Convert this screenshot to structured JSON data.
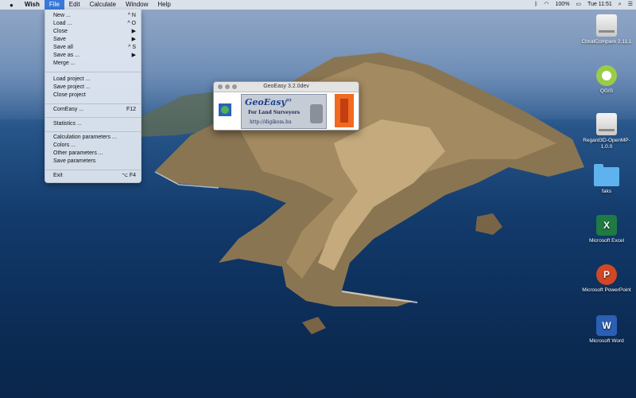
{
  "menubar": {
    "apple_icon": "apple-logo-icon",
    "items": [
      "Wish",
      "File",
      "Edit",
      "Calculate",
      "Window",
      "Help"
    ],
    "status": {
      "bluetooth_icon": "bluetooth-icon",
      "wifi_icon": "wifi-icon",
      "battery": "100%",
      "clock": "Tue 11:51",
      "search_icon": "spotlight-search-icon",
      "list_icon": "notification-list-icon"
    }
  },
  "file_menu": {
    "items": [
      {
        "label": "New ...",
        "shortcut": "^ N"
      },
      {
        "label": "Load ...",
        "shortcut": "^ O"
      },
      {
        "label": "Close",
        "shortcut": "▶"
      },
      {
        "label": "Save",
        "shortcut": "▶"
      },
      {
        "label": "Save all",
        "shortcut": "^ S"
      },
      {
        "label": "Save as ...",
        "shortcut": "▶"
      },
      {
        "label": "Merge ...",
        "shortcut": ""
      },
      {
        "label": "Load project ...",
        "shortcut": ""
      },
      {
        "label": "Save project ...",
        "shortcut": ""
      },
      {
        "label": "Close project",
        "shortcut": ""
      },
      {
        "label": "ComEasy ...",
        "shortcut": "F12"
      },
      {
        "label": "Statistics ...",
        "shortcut": ""
      },
      {
        "label": "Calculation parameters ...",
        "shortcut": ""
      },
      {
        "label": "Colors ...",
        "shortcut": ""
      },
      {
        "label": "Other parameters ...",
        "shortcut": ""
      },
      {
        "label": "Save parameters",
        "shortcut": ""
      },
      {
        "label": "Exit",
        "shortcut": "⌥ F4"
      }
    ]
  },
  "splash": {
    "title": "GeoEasy 3.2.0dev",
    "brand": "GeoEasy",
    "brand_sup": "95",
    "tagline": "For Land Surveyors",
    "url": "http://digikom.hu"
  },
  "desktop_icons": [
    {
      "label": "CloudCompare 2.11.1",
      "icon": "disk-icon"
    },
    {
      "label": "QGIS",
      "icon": "qgis-icon"
    },
    {
      "label": "Regard3D-OpenMP-1.0.0",
      "icon": "disk-icon"
    },
    {
      "label": "faks",
      "icon": "folder-icon"
    },
    {
      "label": "Microsoft Excel",
      "icon": "excel-icon"
    },
    {
      "label": "Microsoft PowerPoint",
      "icon": "powerpoint-icon"
    },
    {
      "label": "Microsoft Word",
      "icon": "word-icon"
    }
  ]
}
